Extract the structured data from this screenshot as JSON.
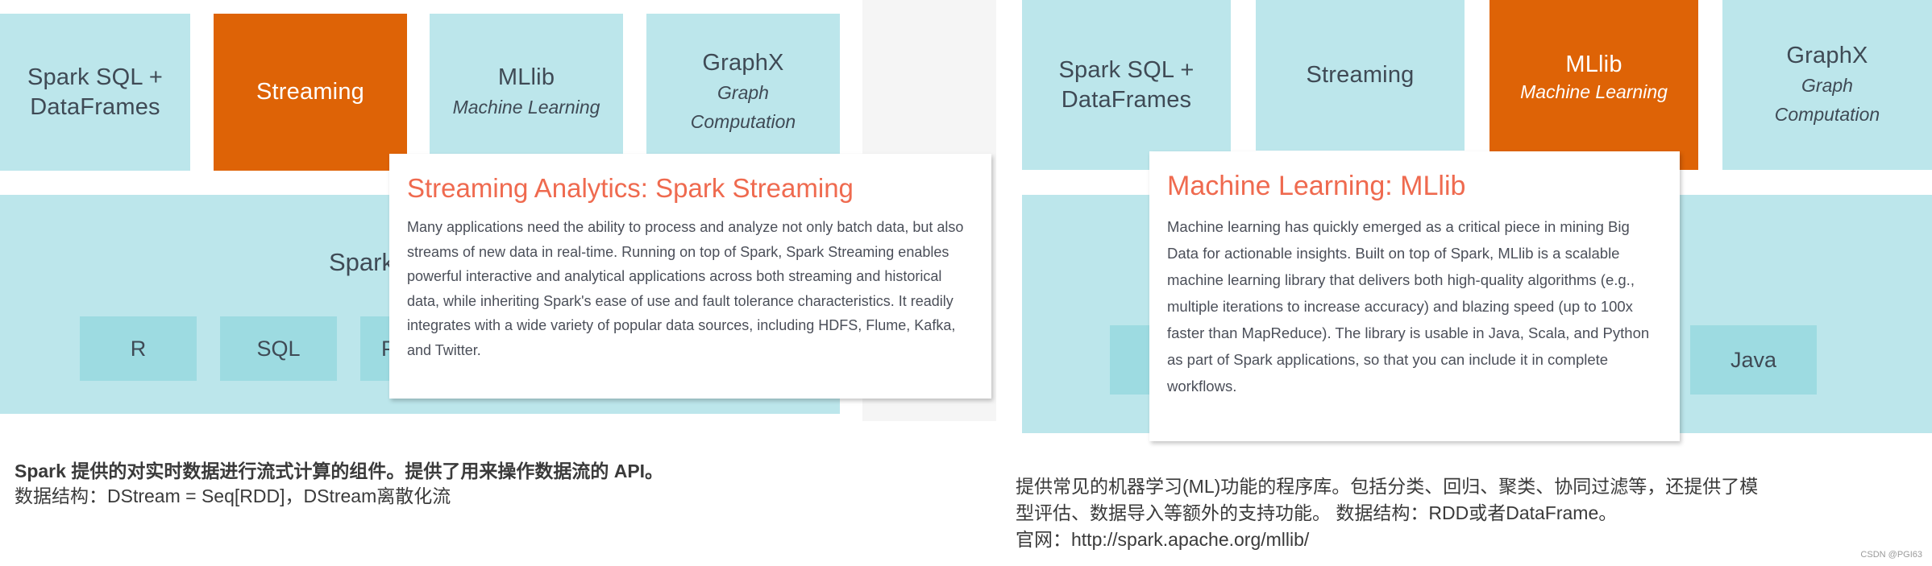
{
  "left": {
    "tiles": [
      {
        "main": "Spark SQL +",
        "main2": "DataFrames",
        "sub": "",
        "active": false
      },
      {
        "main": "Streaming",
        "sub": "",
        "active": true
      },
      {
        "main": "MLlib",
        "sub": "Machine Learning",
        "active": false
      },
      {
        "main": "GraphX",
        "sub": "Graph",
        "sub2": "Computation",
        "active": false
      }
    ],
    "core_title_partial": "Spark",
    "languages": [
      "R",
      "SQL",
      "P"
    ],
    "popup": {
      "title": "Streaming Analytics: Spark Streaming",
      "body": "Many applications need the ability to process and analyze not only batch data, but also streams of new data in real-time. Running on top of Spark, Spark Streaming enables powerful interactive and analytical applications across both streaming and historical data, while inheriting Spark's ease of use and fault tolerance characteristics. It readily integrates with a wide variety of popular data sources, including HDFS, Flume, Kafka, and Twitter."
    },
    "caption": {
      "line1": "Spark 提供的对实时数据进行流式计算的组件。提供了用来操作数据流的 API。",
      "line2": "数据结构：DStream = Seq[RDD]，DStream离散化流"
    }
  },
  "right": {
    "tiles": [
      {
        "main": "Spark SQL +",
        "main2": "DataFrames",
        "sub": "",
        "active": false
      },
      {
        "main": "Streaming",
        "sub": "",
        "active": false
      },
      {
        "main": "MLlib",
        "sub": "Machine Learning",
        "active": true
      },
      {
        "main": "GraphX",
        "sub": "Graph",
        "sub2": "Computation",
        "active": false
      }
    ],
    "languages": [
      "",
      "",
      "Java"
    ],
    "popup": {
      "title": "Machine Learning: MLlib",
      "body": "Machine learning has quickly emerged as a critical piece in mining Big Data for actionable insights. Built on top of Spark, MLlib is a scalable machine learning library that delivers both high-quality algorithms (e.g., multiple iterations to increase accuracy) and blazing speed (up to 100x faster than MapReduce). The library is usable in Java, Scala, and Python as part of Spark applications, so that you can include it in complete workflows."
    },
    "caption": {
      "line1": "提供常见的机器学习(ML)功能的程序库。包括分类、回归、聚类、协同过滤等，还提供了模",
      "line2": "型评估、数据导入等额外的支持功能。 数据结构：RDD或者DataFrame。",
      "line3": "官网：http://spark.apache.org/mllib/"
    }
  },
  "watermark": "CSDN @PGI63",
  "colors": {
    "tile": "#bce6eb",
    "tile_active": "#de6306",
    "lang": "#9ddbe1",
    "popup_title": "#ef6a4f"
  }
}
